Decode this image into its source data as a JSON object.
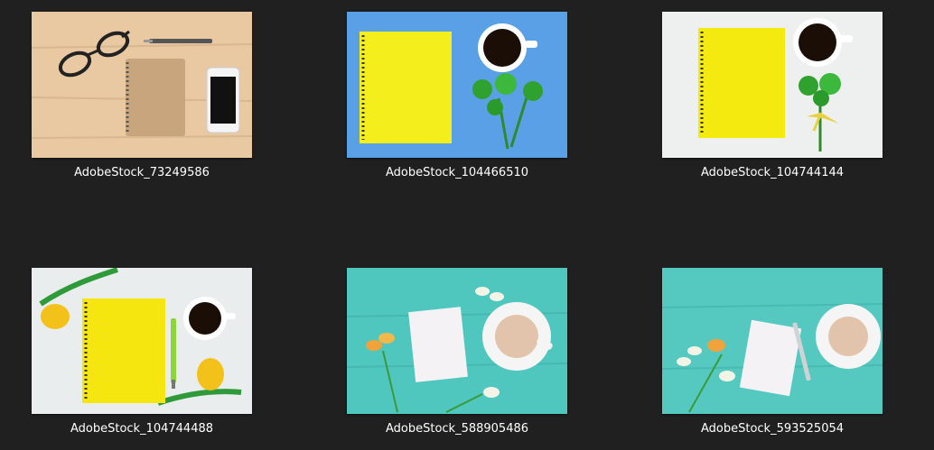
{
  "files": [
    {
      "name": "AdobeStock_73249586",
      "thumbnail": "wood-desk-notebook-glasses-phone"
    },
    {
      "name": "AdobeStock_104466510",
      "thumbnail": "yellow-notebook-blue-coffee-flowers"
    },
    {
      "name": "AdobeStock_104744144",
      "thumbnail": "yellow-notebook-white-coffee-flowers"
    },
    {
      "name": "AdobeStock_104744488",
      "thumbnail": "yellow-notebook-tulips-coffee"
    },
    {
      "name": "AdobeStock_588905486",
      "thumbnail": "teal-notepad-cappuccino-freesia"
    },
    {
      "name": "AdobeStock_593525054",
      "thumbnail": "teal-notepad-pen-cappuccino-freesia"
    }
  ],
  "colors": {
    "background": "#202020",
    "label_text": "#ffffff"
  }
}
